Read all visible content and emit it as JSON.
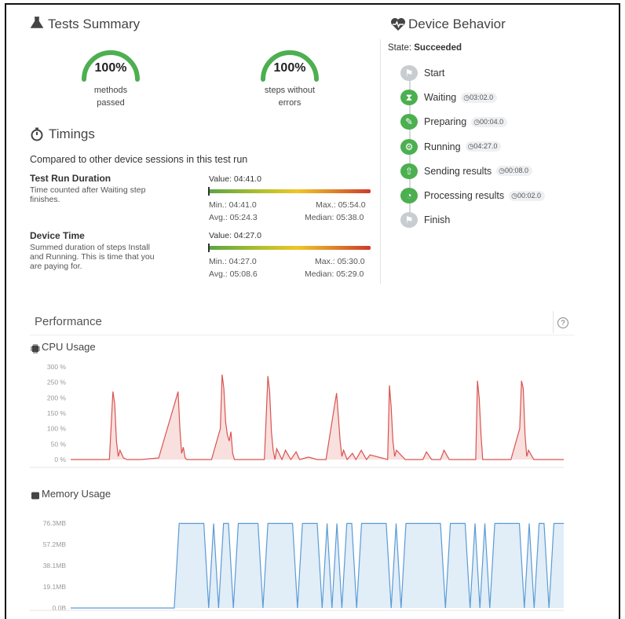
{
  "summary": {
    "title": "Tests Summary",
    "gauge1": {
      "value": "100%",
      "label_l1": "methods",
      "label_l2": "passed",
      "level": 1.0
    },
    "gauge2": {
      "value": "100%",
      "label_l1": "steps without",
      "label_l2": "errors",
      "level": 1.0
    }
  },
  "timings": {
    "title": "Timings",
    "compare": "Compared to other device sessions in this test run",
    "run": {
      "title": "Test Run Duration",
      "desc_l1": "Time counted after Waiting step",
      "desc_l2": "finishes.",
      "value": "Value: 04:41.0",
      "min": "Min.: 04:41.0",
      "max": "Max.: 05:54.0",
      "avg": "Avg.: 05:24.3",
      "median": "Median: 05:38.0",
      "level": 0.0
    },
    "device": {
      "title": "Device Time",
      "desc_l1": "Summed duration of steps Install",
      "desc_l2": "and Running. This is time that you",
      "desc_l3": "are paying for.",
      "value": "Value: 04:27.0",
      "min": "Min.: 04:27.0",
      "max": "Max.: 05:30.0",
      "avg": "Avg.: 05:08.6",
      "median": "Median: 05:29.0",
      "level": 0.0
    }
  },
  "behavior": {
    "title": "Device Behavior",
    "state_label": "State:",
    "state_value": "Succeeded",
    "steps": [
      {
        "label": "Start",
        "time": "",
        "color": "#c8cdd2",
        "icon": "flag-icon"
      },
      {
        "label": "Waiting",
        "time": "03:02.0",
        "color": "#4caf50",
        "icon": "hourglass-icon"
      },
      {
        "label": "Preparing",
        "time": "00:04.0",
        "color": "#4caf50",
        "icon": "wrench-icon"
      },
      {
        "label": "Running",
        "time": "04:27.0",
        "color": "#4caf50",
        "icon": "gears-icon"
      },
      {
        "label": "Sending results",
        "time": "00:08.0",
        "color": "#4caf50",
        "icon": "cloud-upload-icon"
      },
      {
        "label": "Processing results",
        "time": "00:02.0",
        "color": "#4caf50",
        "icon": "pie-icon"
      },
      {
        "label": "Finish",
        "time": "",
        "color": "#c8cdd2",
        "icon": "flag-finish-icon"
      }
    ]
  },
  "performance": {
    "title": "Performance",
    "help": "?",
    "cpu_title": "CPU Usage",
    "mem_title": "Memory Usage"
  },
  "chart_data": [
    {
      "type": "area",
      "title": "CPU Usage",
      "yticks": [
        "300 %",
        "250 %",
        "200 %",
        "150 %",
        "100 %",
        "50 %",
        "0 %"
      ],
      "ylim": [
        0,
        300
      ],
      "color": "#d9534f",
      "x": [
        0,
        8,
        22,
        23,
        24,
        25,
        26,
        27,
        28,
        30,
        32,
        40,
        50,
        60,
        61,
        62,
        63,
        64,
        65,
        66,
        70,
        80,
        85,
        86,
        87,
        88,
        89,
        90,
        91,
        92,
        93,
        95,
        110,
        112,
        113,
        114,
        115,
        116,
        117,
        120,
        122,
        125,
        128,
        130,
        135,
        140,
        145,
        150,
        151,
        152,
        153,
        154,
        155,
        157,
        160,
        162,
        165,
        168,
        170,
        180,
        181,
        182,
        183,
        184,
        185,
        190,
        195,
        200,
        202,
        205,
        210,
        212,
        215,
        218,
        220,
        230,
        231,
        232,
        233,
        234,
        235,
        240,
        250,
        255,
        256,
        257,
        258,
        259,
        260,
        263,
        266,
        270,
        275,
        280
      ],
      "values": [
        0,
        0,
        0,
        110,
        220,
        180,
        60,
        10,
        30,
        5,
        0,
        0,
        5,
        200,
        220,
        100,
        20,
        40,
        5,
        0,
        0,
        0,
        100,
        275,
        230,
        120,
        80,
        60,
        90,
        20,
        0,
        0,
        0,
        270,
        220,
        90,
        30,
        0,
        35,
        0,
        30,
        0,
        25,
        0,
        8,
        0,
        0,
        180,
        215,
        140,
        60,
        10,
        30,
        0,
        20,
        0,
        30,
        0,
        15,
        0,
        240,
        170,
        60,
        10,
        30,
        0,
        0,
        0,
        25,
        0,
        0,
        30,
        0,
        0,
        0,
        0,
        255,
        200,
        80,
        0,
        0,
        0,
        0,
        100,
        255,
        230,
        80,
        10,
        30,
        0,
        0,
        0,
        0,
        0
      ]
    },
    {
      "type": "area",
      "title": "Memory Usage",
      "yticks": [
        "76.3MB",
        "57.2MB",
        "38.1MB",
        "19.1MB",
        "0.0B"
      ],
      "ylim": [
        0,
        76.3
      ],
      "color": "#5b9bd5",
      "x": [
        0,
        20,
        21,
        22,
        23,
        24,
        25,
        26,
        27,
        28,
        29,
        30,
        31,
        32,
        33,
        34,
        35,
        36,
        37,
        38,
        39,
        40,
        41,
        42,
        43,
        44,
        45,
        46,
        47,
        48,
        49,
        50,
        51,
        52,
        53,
        54,
        55,
        56,
        57,
        58,
        59,
        60,
        61,
        62,
        63,
        64,
        65,
        66,
        67,
        68,
        69,
        70,
        71,
        72,
        73,
        74,
        75,
        76,
        77,
        78,
        79,
        80,
        81,
        82,
        83,
        84,
        85,
        86,
        87,
        88,
        89,
        90,
        91,
        92,
        93,
        94,
        95,
        96,
        97,
        98,
        99,
        100
      ],
      "values": [
        0,
        0,
        0,
        76,
        76,
        76,
        76,
        76,
        76,
        0,
        76,
        0,
        76,
        76,
        0,
        76,
        76,
        76,
        76,
        76,
        0,
        76,
        76,
        76,
        76,
        76,
        76,
        0,
        76,
        76,
        76,
        76,
        0,
        76,
        0,
        76,
        0,
        76,
        76,
        0,
        76,
        76,
        76,
        76,
        76,
        76,
        0,
        76,
        0,
        76,
        76,
        76,
        76,
        76,
        76,
        76,
        76,
        0,
        76,
        76,
        76,
        76,
        0,
        76,
        0,
        76,
        0,
        76,
        76,
        76,
        76,
        76,
        76,
        0,
        76,
        0,
        76,
        76,
        0,
        76,
        76,
        76
      ]
    }
  ]
}
